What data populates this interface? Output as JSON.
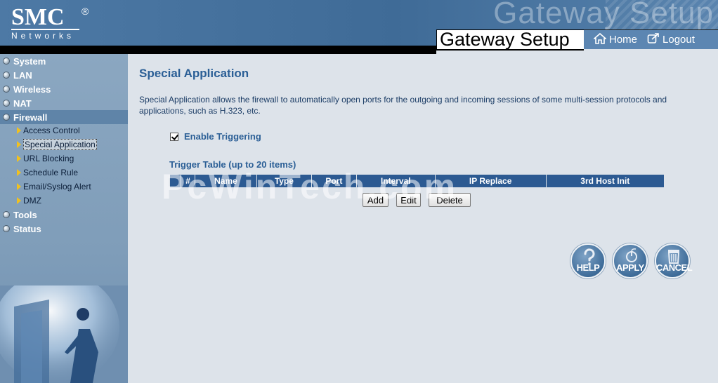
{
  "brand": {
    "logo": "SMC",
    "logo_mark": "®",
    "sub": "Networks"
  },
  "header": {
    "watermark": "Gateway Setup",
    "title": "Gateway Setup",
    "home_label": "Home",
    "logout_label": "Logout"
  },
  "sidebar": {
    "items": [
      {
        "label": "System"
      },
      {
        "label": "LAN"
      },
      {
        "label": "Wireless"
      },
      {
        "label": "NAT"
      },
      {
        "label": "Firewall"
      },
      {
        "label": "Tools"
      },
      {
        "label": "Status"
      }
    ],
    "firewall_sub": [
      {
        "label": "Access Control"
      },
      {
        "label": "Special Application"
      },
      {
        "label": "URL Blocking"
      },
      {
        "label": "Schedule Rule"
      },
      {
        "label": "Email/Syslog Alert"
      },
      {
        "label": "DMZ"
      }
    ]
  },
  "main": {
    "title": "Special Application",
    "description": "Special Application allows the firewall to automatically open ports for the outgoing and incoming sessions of some multi-session protocols and applications, such as H.323, etc.",
    "enable_label": "Enable Triggering",
    "enable_checked": true,
    "table_title": "Trigger Table (up to 20 items)",
    "columns": [
      "",
      "#",
      "Name",
      "Type",
      "Port",
      "Interval",
      "IP Replace",
      "3rd Host Init"
    ],
    "buttons": {
      "add": "Add",
      "edit": "Edit",
      "delete": "Delete"
    },
    "watermark": "PcWinTech.com"
  },
  "actions": {
    "help": "HELP",
    "apply": "APPLY",
    "cancel": "CANCEL"
  },
  "colors": {
    "header": "#4d79a5",
    "sidebar": "#8ba7c1",
    "table_header": "#2c5a92",
    "title": "#2b5f96"
  }
}
